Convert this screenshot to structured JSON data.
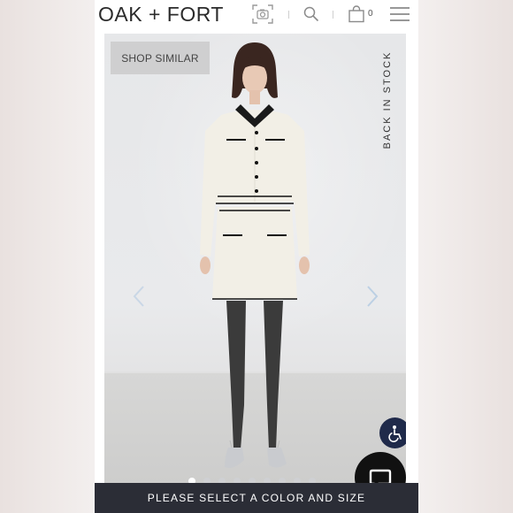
{
  "header": {
    "brand": "OAK + FORT",
    "cart_count": "0",
    "icons": [
      "camera-search-icon",
      "search-icon",
      "shopping-bag-icon",
      "hamburger-menu-icon"
    ]
  },
  "product": {
    "shop_similar_label": "SHOP SIMILAR",
    "badge": "BACK IN STOCK",
    "carousel": {
      "total_slides": 9,
      "active_index": 0
    }
  },
  "actions": {
    "select_prompt": "PLEASE SELECT A COLOR AND SIZE"
  },
  "colors": {
    "cta_bg": "#2b2d36",
    "accessibility_bg": "#1f2a4a",
    "chat_bg": "#111111",
    "shop_similar_bg": "#cfcfd0"
  }
}
